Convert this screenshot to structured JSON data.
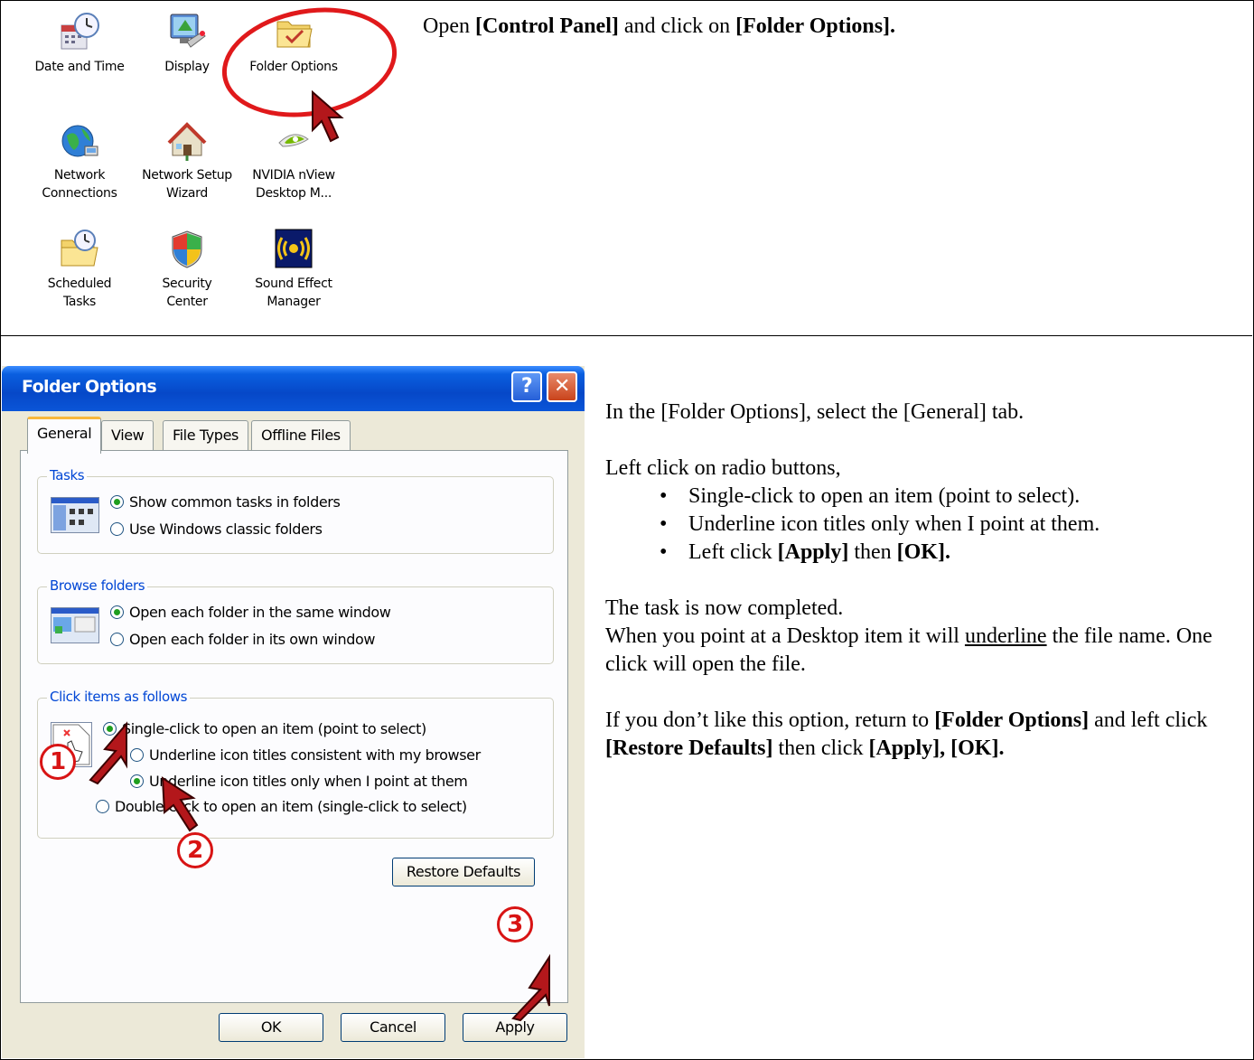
{
  "control_panel": {
    "items": [
      {
        "label_1": "Date and Time",
        "label_2": "",
        "icon": "date-time-icon"
      },
      {
        "label_1": "Display",
        "label_2": "",
        "icon": "display-icon"
      },
      {
        "label_1": "Folder Options",
        "label_2": "",
        "icon": "folder-options-icon"
      },
      {
        "label_1": "Network",
        "label_2": "Connections",
        "icon": "network-connections-icon"
      },
      {
        "label_1": "Network Setup",
        "label_2": "Wizard",
        "icon": "network-setup-icon"
      },
      {
        "label_1": "NVIDIA nView",
        "label_2": "Desktop M...",
        "icon": "nvidia-icon"
      },
      {
        "label_1": "Scheduled",
        "label_2": "Tasks",
        "icon": "scheduled-tasks-icon"
      },
      {
        "label_1": "Security",
        "label_2": "Center",
        "icon": "security-center-icon"
      },
      {
        "label_1": "Sound Effect",
        "label_2": "Manager",
        "icon": "sound-effect-icon"
      }
    ]
  },
  "instructions": {
    "step1": {
      "pre": "Open ",
      "b1": "[Control Panel]",
      "mid": " and click on ",
      "b2": "[Folder Options]."
    },
    "step2": {
      "p1": "In the [Folder Options], select the [General] tab.",
      "p2": "Left click on radio buttons,",
      "bullets": [
        "Single-click to open an item (point to select).",
        "Underline icon titles only when I point at them."
      ],
      "bullet3_pre": "Left click ",
      "bullet3_b1": "[Apply]",
      "bullet3_mid": " then ",
      "bullet3_b2": "[OK].",
      "p3": "The task is now completed.",
      "p4_pre": "When you point at a Desktop item it will ",
      "p4_u": "underline",
      "p4_post": " the file name. One click will open the file.",
      "p5_pre": "If you don’t like this option, return to ",
      "p5_b1": "[Folder Options]",
      "p5_mid1": " and left click ",
      "p5_b2": "[Restore Defaults]",
      "p5_mid2": " then click ",
      "p5_b3": "[Apply], [OK]."
    }
  },
  "dialog": {
    "title": "Folder Options",
    "help_glyph": "?",
    "close_glyph": "✕",
    "tabs": [
      "General",
      "View",
      "File Types",
      "Offline Files"
    ],
    "active_tab": "General",
    "groups": {
      "tasks": {
        "title": "Tasks",
        "options": [
          "Show common tasks in folders",
          "Use Windows classic folders"
        ],
        "selected": 0
      },
      "browse": {
        "title": "Browse folders",
        "options": [
          "Open each folder in the same window",
          "Open each folder in its own window"
        ],
        "selected": 0
      },
      "click": {
        "title": "Click items as follows",
        "options": [
          "Single-click to open an item (point to select)",
          "Underline icon titles consistent with my browser",
          "Underline icon titles only when I point at them",
          "Double-click to open an item (single-click to select)"
        ],
        "selected": [
          0,
          2
        ]
      }
    },
    "restore_defaults": "Restore Defaults",
    "ok": "OK",
    "cancel": "Cancel",
    "apply": "Apply",
    "step_markers": [
      "1",
      "2",
      "3"
    ]
  },
  "colors": {
    "annotation_red": "#d81414",
    "title_bar_blue": "#0648c8",
    "group_title_blue": "#0046d5",
    "dialog_face": "#ece9d8"
  }
}
